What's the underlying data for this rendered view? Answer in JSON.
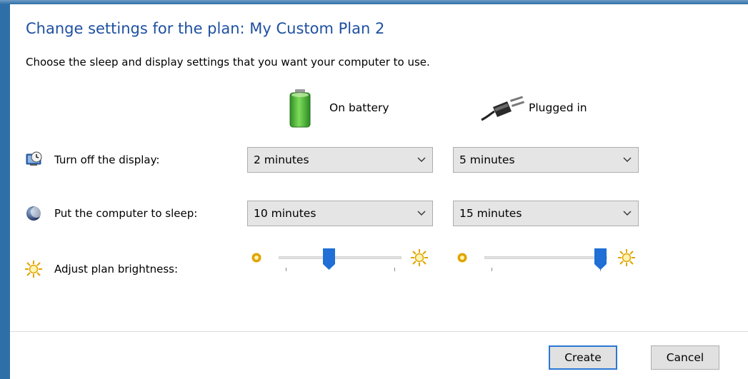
{
  "header": {
    "title": "Change settings for the plan: My Custom Plan 2",
    "subtitle": "Choose the sleep and display settings that you want your computer to use."
  },
  "columns": {
    "battery_label": "On battery",
    "plugged_label": "Plugged in"
  },
  "rows": {
    "display": {
      "label": "Turn off the display:",
      "battery_value": "2 minutes",
      "plugged_value": "5 minutes"
    },
    "sleep": {
      "label": "Put the computer to sleep:",
      "battery_value": "10 minutes",
      "plugged_value": "15 minutes"
    },
    "brightness": {
      "label": "Adjust plan brightness:",
      "battery_level_fraction": 0.4,
      "plugged_level_fraction": 1.0
    }
  },
  "icons": {
    "battery": "battery-icon",
    "plug": "plug-icon",
    "display": "display-timer-icon",
    "sleep": "sleep-moon-icon",
    "brightness": "sun-icon"
  },
  "colors": {
    "title": "#1e50a0",
    "accent": "#1f6fd6",
    "battery_green": "#3aa82e",
    "sun": "#f2b705"
  },
  "footer": {
    "create_label": "Create",
    "cancel_label": "Cancel"
  }
}
